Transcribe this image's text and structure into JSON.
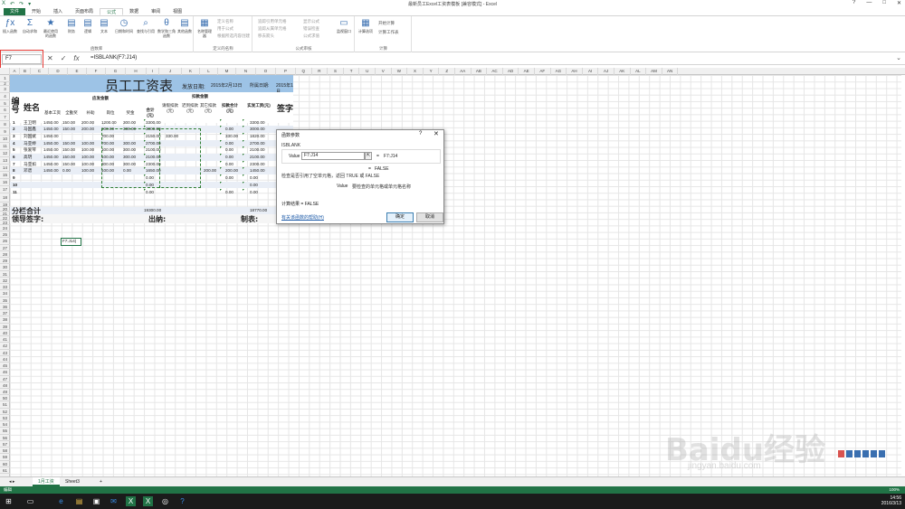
{
  "titlebar": {
    "title": "最新员工Excel工资表模板 [兼容模式] - Excel",
    "qat": [
      "X",
      "↶",
      "↷",
      "▾"
    ],
    "controls": [
      "?",
      "—",
      "□",
      "✕"
    ]
  },
  "tabs": [
    "文件",
    "开始",
    "插入",
    "页面布局",
    "公式",
    "数据",
    "审阅",
    "视图"
  ],
  "active_tab": "公式",
  "ribbon": {
    "groups": [
      {
        "label": "函数库",
        "buttons": [
          "插入函数",
          "自动求和",
          "最近使用的函数",
          "财务",
          "逻辑",
          "文本",
          "日期和时间",
          "查找与引用",
          "数学和三角函数",
          "其他函数"
        ]
      },
      {
        "label": "定义的名称",
        "buttons": [
          "名称管理器"
        ],
        "small": [
          "定义名称",
          "用于公式",
          "根据所选内容创建"
        ]
      },
      {
        "label": "公式审核",
        "small": [
          "追踪引用单元格",
          "追踪从属单元格",
          "移去箭头",
          "显示公式",
          "错误检查",
          "公式求值"
        ],
        "buttons": [
          "监视窗口"
        ]
      },
      {
        "label": "计算",
        "buttons": [
          "计算选项"
        ],
        "small": [
          "开始计算",
          "计算工作表"
        ]
      }
    ]
  },
  "formula_bar": {
    "namebox": "F7",
    "fx": "fx",
    "formula": "=ISBLANK(F7:J14)"
  },
  "columns": [
    "A",
    "B",
    "C",
    "D",
    "E",
    "F",
    "G",
    "H",
    "I",
    "J",
    "K",
    "L",
    "M",
    "N",
    "O",
    "P",
    "Q",
    "R",
    "S",
    "T",
    "U",
    "V",
    "W",
    "X",
    "Y",
    "Z",
    "AA",
    "AB",
    "AC",
    "AD",
    "AE",
    "AF",
    "AG",
    "AH",
    "AI",
    "AJ",
    "AK",
    "AL",
    "AM",
    "AN"
  ],
  "rows": [
    "1",
    "2",
    "3",
    "4",
    "5",
    "6",
    "7",
    "8",
    "9",
    "10",
    "11",
    "12",
    "13",
    "14",
    "15",
    "16",
    "17",
    "18",
    "19",
    "20",
    "21",
    "22",
    "23",
    "24",
    "25",
    "26",
    "27",
    "28",
    "29",
    "30",
    "31",
    "32",
    "33",
    "34",
    "35",
    "36",
    "37",
    "38",
    "39",
    "40",
    "41",
    "42",
    "43",
    "44",
    "45",
    "46",
    "47",
    "48",
    "49",
    "50",
    "51",
    "52",
    "53",
    "54",
    "55",
    "56",
    "57",
    "58",
    "59",
    "60",
    "61"
  ],
  "sheet": {
    "title": "员工工资表",
    "pay_date_label": "发放日期:",
    "pay_date": "2015年2月13日",
    "belong_label": "所属日期:",
    "belong_date": "2015年1月",
    "headers": {
      "no": "编号",
      "name": "姓名",
      "should_pay": "应发金额",
      "deduct": "扣款金额",
      "base": "基本工资",
      "full": "全勤奖",
      "subsidy": "补助",
      "post": "岗位",
      "bonus": "奖金",
      "total": "合计(元)",
      "leave": "请假扣款(元)",
      "late": "迟到扣款(元)",
      "other": "其它扣款(元)",
      "deduct_total": "扣款合计(元)",
      "real": "实发工资(元)",
      "sign": "签字"
    },
    "rows": [
      {
        "no": "1",
        "name": "王卫明",
        "c": [
          "1450.00",
          "150.00",
          "200.00",
          "1200.00",
          "300.00",
          "3300.00",
          "",
          "",
          "",
          "",
          "3300.00"
        ]
      },
      {
        "no": "2",
        "name": "马国鑫",
        "c": [
          "1450.00",
          "150.00",
          "200.00",
          "900.00",
          "300.00",
          "3000.00",
          "",
          "",
          "",
          "0.00",
          "3000.00"
        ]
      },
      {
        "no": "3",
        "name": "刘国斌",
        "c": [
          "1450.00",
          "",
          "",
          "700.00",
          "",
          "2150.00",
          "330.00",
          "",
          "",
          "330.00",
          "1820.00"
        ]
      },
      {
        "no": "4",
        "name": "马亚婷",
        "c": [
          "1450.00",
          "150.00",
          "100.00",
          "700.00",
          "300.00",
          "2700.00",
          "",
          "",
          "",
          "0.00",
          "2700.00"
        ]
      },
      {
        "no": "5",
        "name": "张爱琴",
        "c": [
          "1450.00",
          "150.00",
          "100.00",
          "100.00",
          "300.00",
          "2100.00",
          "",
          "",
          "",
          "0.00",
          "2100.00"
        ]
      },
      {
        "no": "6",
        "name": "高玥",
        "c": [
          "1450.00",
          "150.00",
          "100.00",
          "100.00",
          "300.00",
          "2100.00",
          "",
          "",
          "",
          "0.00",
          "2100.00"
        ]
      },
      {
        "no": "7",
        "name": "马亚如",
        "c": [
          "1450.00",
          "150.00",
          "100.00",
          "300.00",
          "300.00",
          "2300.00",
          "",
          "",
          "",
          "0.00",
          "2300.00"
        ]
      },
      {
        "no": "8",
        "name": "邓谱",
        "c": [
          "1450.00",
          "0.00",
          "100.00",
          "100.00",
          "0.00",
          "1650.00",
          "",
          "",
          "200.00",
          "200.00",
          "1450.00"
        ]
      },
      {
        "no": "9",
        "name": "",
        "c": [
          "",
          "",
          "",
          "",
          "",
          "0.00",
          "",
          "",
          "",
          "0.00",
          "0.00"
        ]
      },
      {
        "no": "10",
        "name": "",
        "c": [
          "",
          "",
          "",
          "",
          "",
          "0.00",
          "",
          "",
          "",
          "",
          "0.00"
        ]
      },
      {
        "no": "11",
        "name": "",
        "c": [
          "",
          "",
          "",
          "",
          "",
          "0.00",
          "",
          "",
          "",
          "0.00",
          "0.00"
        ]
      }
    ],
    "subtotal_label": "分栏合计",
    "subtotal_total": "19300.00",
    "subtotal_real": "18770.00",
    "footer": {
      "leader": "领导签字:",
      "cashier": "出纳:",
      "maker": "制表:"
    }
  },
  "active_cell_text": "F7:J14)",
  "dialog": {
    "title": "函数参数",
    "help": "?",
    "close": "✕",
    "function_name": "ISBLANK",
    "param_label": "Value",
    "param_value": "F7:J14",
    "collapse": "⇱",
    "eq": "=",
    "param_result": "F7:J14",
    "fn_result_eq": "=",
    "fn_result": "FALSE",
    "description": "检查是否引用了空单元格，返回 TRUE 或 FALSE",
    "param_desc_name": "Value",
    "param_desc": "要检查的单元格或单元格名称",
    "calc_result": "计算结果 =   FALSE",
    "help_link": "有关该函数的帮助(H)",
    "ok": "确定",
    "cancel": "取消"
  },
  "sheet_tabs": [
    "1月工资",
    "Sheet3"
  ],
  "add_sheet": "+",
  "status": {
    "left": "编辑",
    "zoom": "100%"
  },
  "taskbar": {
    "time": "14:56",
    "date": "2016/3/13",
    "icons": [
      "⊞",
      "▭",
      "e",
      "▤",
      "▣",
      "✉",
      "X",
      "X",
      "◎",
      "?"
    ]
  },
  "watermark": {
    "text": "Baidu经验",
    "url": "jingyan.baidu.com"
  },
  "colors": {
    "excel_green": "#217346",
    "title_band": "#9dc3e6",
    "alt_row": "#e9eef6",
    "highlight": "#e53935"
  }
}
